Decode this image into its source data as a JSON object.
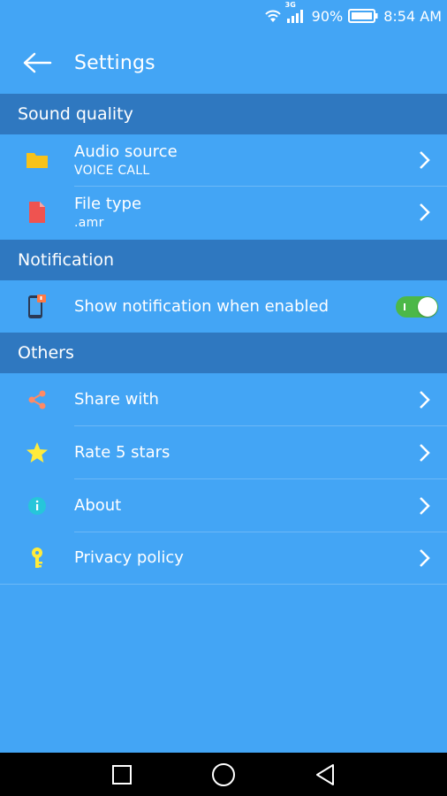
{
  "status": {
    "battery": "90%",
    "time": "8:54 AM",
    "network": "3G"
  },
  "header": {
    "title": "Settings"
  },
  "sections": {
    "sound": {
      "title": "Sound quality"
    },
    "notification": {
      "title": "Notification"
    },
    "others": {
      "title": "Others"
    }
  },
  "items": {
    "audio_source": {
      "label": "Audio source",
      "value": "VOICE CALL"
    },
    "file_type": {
      "label": "File type",
      "value": ".amr"
    },
    "show_notification": {
      "label": "Show notification when enabled",
      "enabled": true
    },
    "share": {
      "label": "Share with"
    },
    "rate": {
      "label": "Rate 5 stars"
    },
    "about": {
      "label": "About"
    },
    "privacy": {
      "label": "Privacy policy"
    }
  },
  "colors": {
    "background": "#43a5f5",
    "section": "#2f78c0",
    "toggle_on": "#4cb848",
    "folder": "#f7c21a",
    "file": "#ef5350",
    "star": "#ffeb3b",
    "key": "#ffeb3b"
  }
}
